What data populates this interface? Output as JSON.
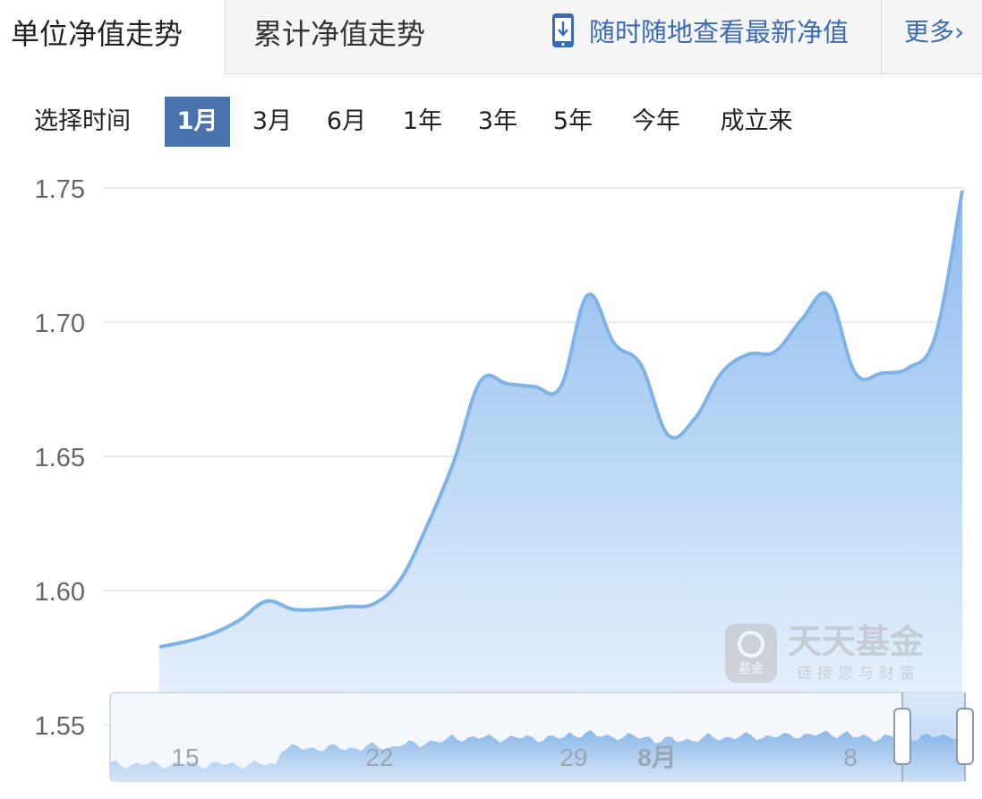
{
  "tabs": {
    "unit_nav": "单位净值走势",
    "acc_nav": "累计净值走势",
    "mobile_link": "随时随地查看最新净值",
    "more": "更多",
    "more_arrow": "›"
  },
  "range": {
    "label": "选择时间",
    "options": [
      "1月",
      "3月",
      "6月",
      "1年",
      "3年",
      "5年",
      "今年",
      "成立来"
    ],
    "active": "1月"
  },
  "watermark": {
    "brand": "天天基金",
    "slogan": "链接您与财富",
    "logo_text": "基金"
  },
  "chart_data": {
    "type": "area",
    "y_ticks": [
      "1.75",
      "1.70",
      "1.65",
      "1.60",
      "1.55"
    ],
    "ylim": [
      1.55,
      1.75
    ],
    "x_ticks": [
      "15",
      "22",
      "29",
      "8月",
      "8"
    ],
    "series": [
      {
        "values": [
          1.579,
          1.581,
          1.584,
          1.589,
          1.596,
          1.593,
          1.593,
          1.594,
          1.595,
          1.604,
          1.624,
          1.648,
          1.678,
          1.677,
          1.676,
          1.676,
          1.71,
          1.692,
          1.684,
          1.658,
          1.664,
          1.681,
          1.688,
          1.689,
          1.701,
          1.71,
          1.681,
          1.681,
          1.683,
          1.695,
          1.749
        ]
      }
    ],
    "line_color": "#7eb3e8",
    "fill_top_color": "#94bfee",
    "grid": true
  }
}
